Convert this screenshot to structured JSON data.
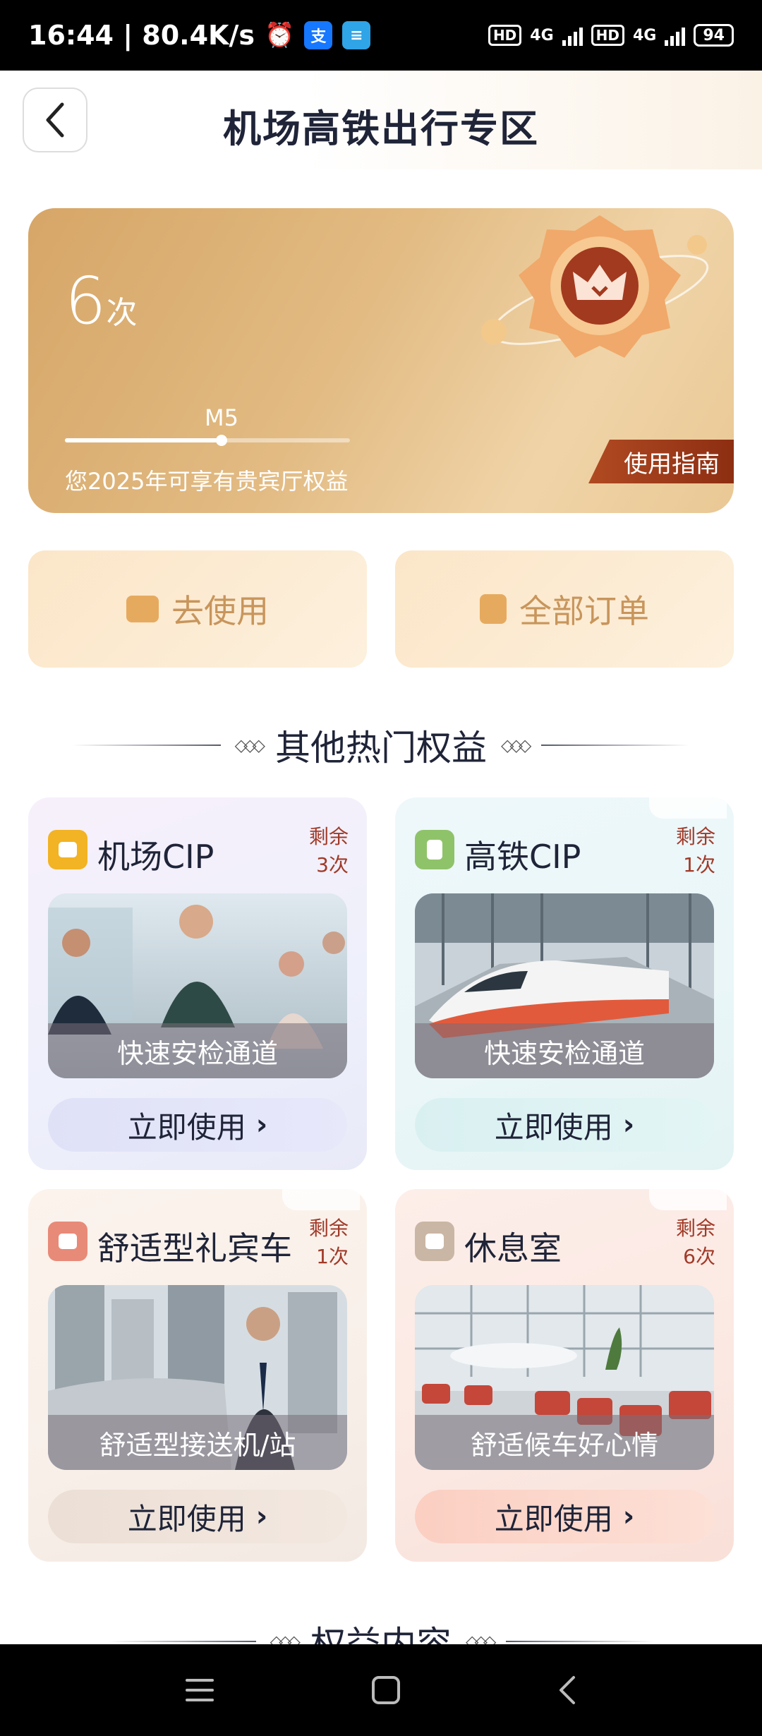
{
  "status_bar": {
    "time_speed": "16:44 | 80.4K/s",
    "hd1": "HD",
    "net1": "4G",
    "hd2": "HD",
    "net2": "4G",
    "battery": "94"
  },
  "header": {
    "title": "机场高铁出行专区"
  },
  "hero": {
    "count": "6",
    "count_unit": "次",
    "level_label": "M5",
    "level_progress": 0.55,
    "subtitle": "您2025年可享有贵宾厅权益",
    "guide_label": "使用指南"
  },
  "actions": {
    "use_label": "去使用",
    "orders_label": "全部订单"
  },
  "sections": {
    "hot_title": "其他热门权益",
    "content_title": "权益内容"
  },
  "benefits": [
    {
      "title": "机场CIP",
      "remain_label": "剩余",
      "remain_count": "3次",
      "caption": "快速安检通道",
      "button": "立即使用",
      "icon": "seat-icon",
      "icon_color": "#f2b324"
    },
    {
      "title": "高铁CIP",
      "remain_label": "剩余",
      "remain_count": "1次",
      "caption": "快速安检通道",
      "button": "立即使用",
      "icon": "train-icon",
      "icon_color": "#8fc36a"
    },
    {
      "title": "舒适型礼宾车",
      "remain_label": "剩余",
      "remain_count": "1次",
      "caption": "舒适型接送机/站",
      "button": "立即使用",
      "icon": "bus-icon",
      "icon_color": "#e88a78"
    },
    {
      "title": "休息室",
      "remain_label": "剩余",
      "remain_count": "6次",
      "caption": "舒适候车好心情",
      "button": "立即使用",
      "icon": "car-icon",
      "icon_color": "#c9b6a4"
    }
  ],
  "colors": {
    "hero_gold": "#d6a667",
    "guide_red": "#a13a1a",
    "remain_red": "#a13a28",
    "title_navy": "#1f2438"
  }
}
